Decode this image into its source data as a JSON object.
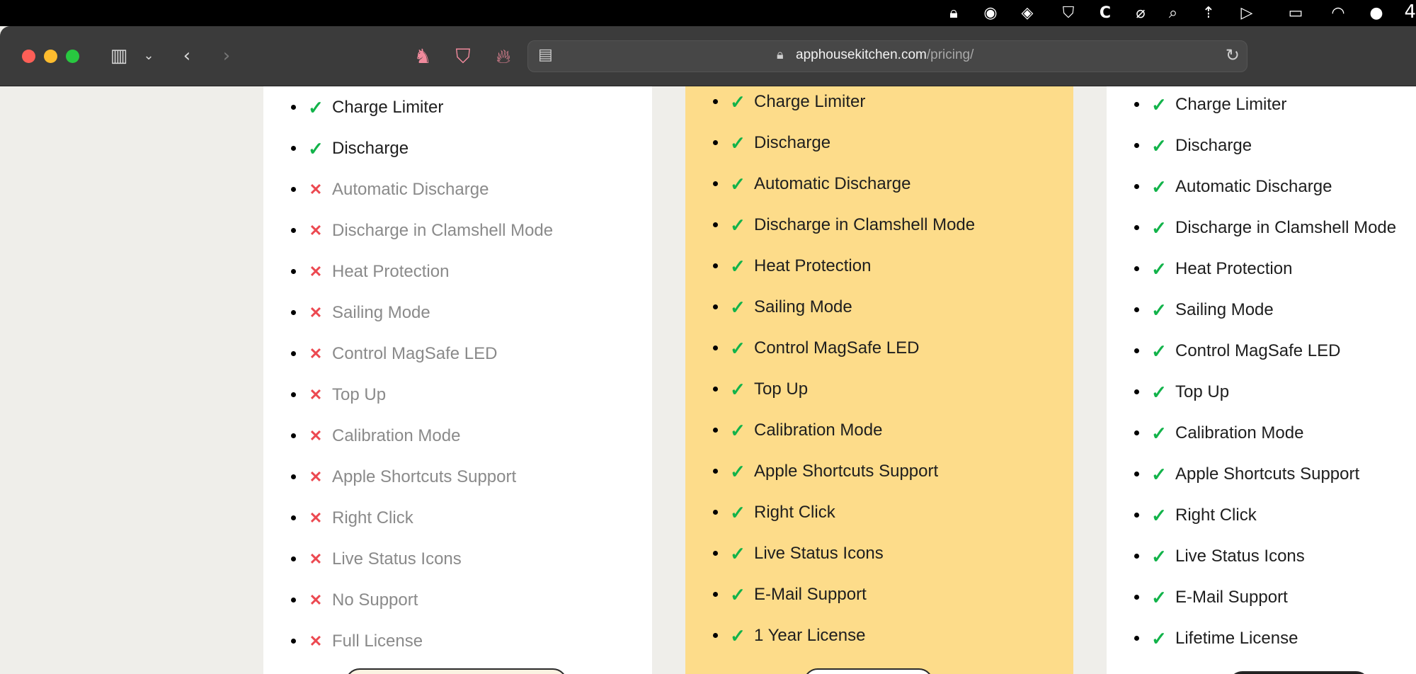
{
  "menubar": {
    "icons": [
      "lock-icon",
      "user-circle-icon",
      "layers-icon",
      "shield-icon",
      "c-app-icon",
      "paperclip-icon",
      "search-icon",
      "rocket-icon",
      "play-circle-icon",
      "battery-icon",
      "wifi-icon",
      "toggle-icon"
    ],
    "clock_partial": "4"
  },
  "browser": {
    "url_domain": "apphousekitchen.com",
    "url_path": "/pricing/",
    "extension_icons": [
      "ghost-icon",
      "adguard-shield-icon",
      "flame-icon"
    ]
  },
  "colors": {
    "check": "#12b34a",
    "cross": "#ec4850",
    "highlight_card": "#fddc8a"
  },
  "plans": [
    {
      "features": [
        {
          "label": "Charge Limiter",
          "included": true
        },
        {
          "label": "Discharge",
          "included": true
        },
        {
          "label": "Automatic Discharge",
          "included": false
        },
        {
          "label": "Discharge in Clamshell Mode",
          "included": false
        },
        {
          "label": "Heat Protection",
          "included": false
        },
        {
          "label": "Sailing Mode",
          "included": false
        },
        {
          "label": "Control MagSafe LED",
          "included": false
        },
        {
          "label": "Top Up",
          "included": false
        },
        {
          "label": "Calibration Mode",
          "included": false
        },
        {
          "label": "Apple Shortcuts Support",
          "included": false
        },
        {
          "label": "Right Click",
          "included": false
        },
        {
          "label": "Live Status Icons",
          "included": false
        },
        {
          "label": "No Support",
          "included": false
        },
        {
          "label": "Full License",
          "included": false
        }
      ]
    },
    {
      "features": [
        {
          "label": "Charge Limiter",
          "included": true
        },
        {
          "label": "Discharge",
          "included": true
        },
        {
          "label": "Automatic Discharge",
          "included": true
        },
        {
          "label": "Discharge in Clamshell Mode",
          "included": true
        },
        {
          "label": "Heat Protection",
          "included": true
        },
        {
          "label": "Sailing Mode",
          "included": true
        },
        {
          "label": "Control MagSafe LED",
          "included": true
        },
        {
          "label": "Top Up",
          "included": true
        },
        {
          "label": "Calibration Mode",
          "included": true
        },
        {
          "label": "Apple Shortcuts Support",
          "included": true
        },
        {
          "label": "Right Click",
          "included": true
        },
        {
          "label": "Live Status Icons",
          "included": true
        },
        {
          "label": "E-Mail Support",
          "included": true
        },
        {
          "label": "1 Year License",
          "included": true
        }
      ]
    },
    {
      "features": [
        {
          "label": "Charge Limiter",
          "included": true
        },
        {
          "label": "Discharge",
          "included": true
        },
        {
          "label": "Automatic Discharge",
          "included": true
        },
        {
          "label": "Discharge in Clamshell Mode",
          "included": true
        },
        {
          "label": "Heat Protection",
          "included": true
        },
        {
          "label": "Sailing Mode",
          "included": true
        },
        {
          "label": "Control MagSafe LED",
          "included": true
        },
        {
          "label": "Top Up",
          "included": true
        },
        {
          "label": "Calibration Mode",
          "included": true
        },
        {
          "label": "Apple Shortcuts Support",
          "included": true
        },
        {
          "label": "Right Click",
          "included": true
        },
        {
          "label": "Live Status Icons",
          "included": true
        },
        {
          "label": "E-Mail Support",
          "included": true
        },
        {
          "label": "Lifetime License",
          "included": true
        }
      ]
    }
  ]
}
